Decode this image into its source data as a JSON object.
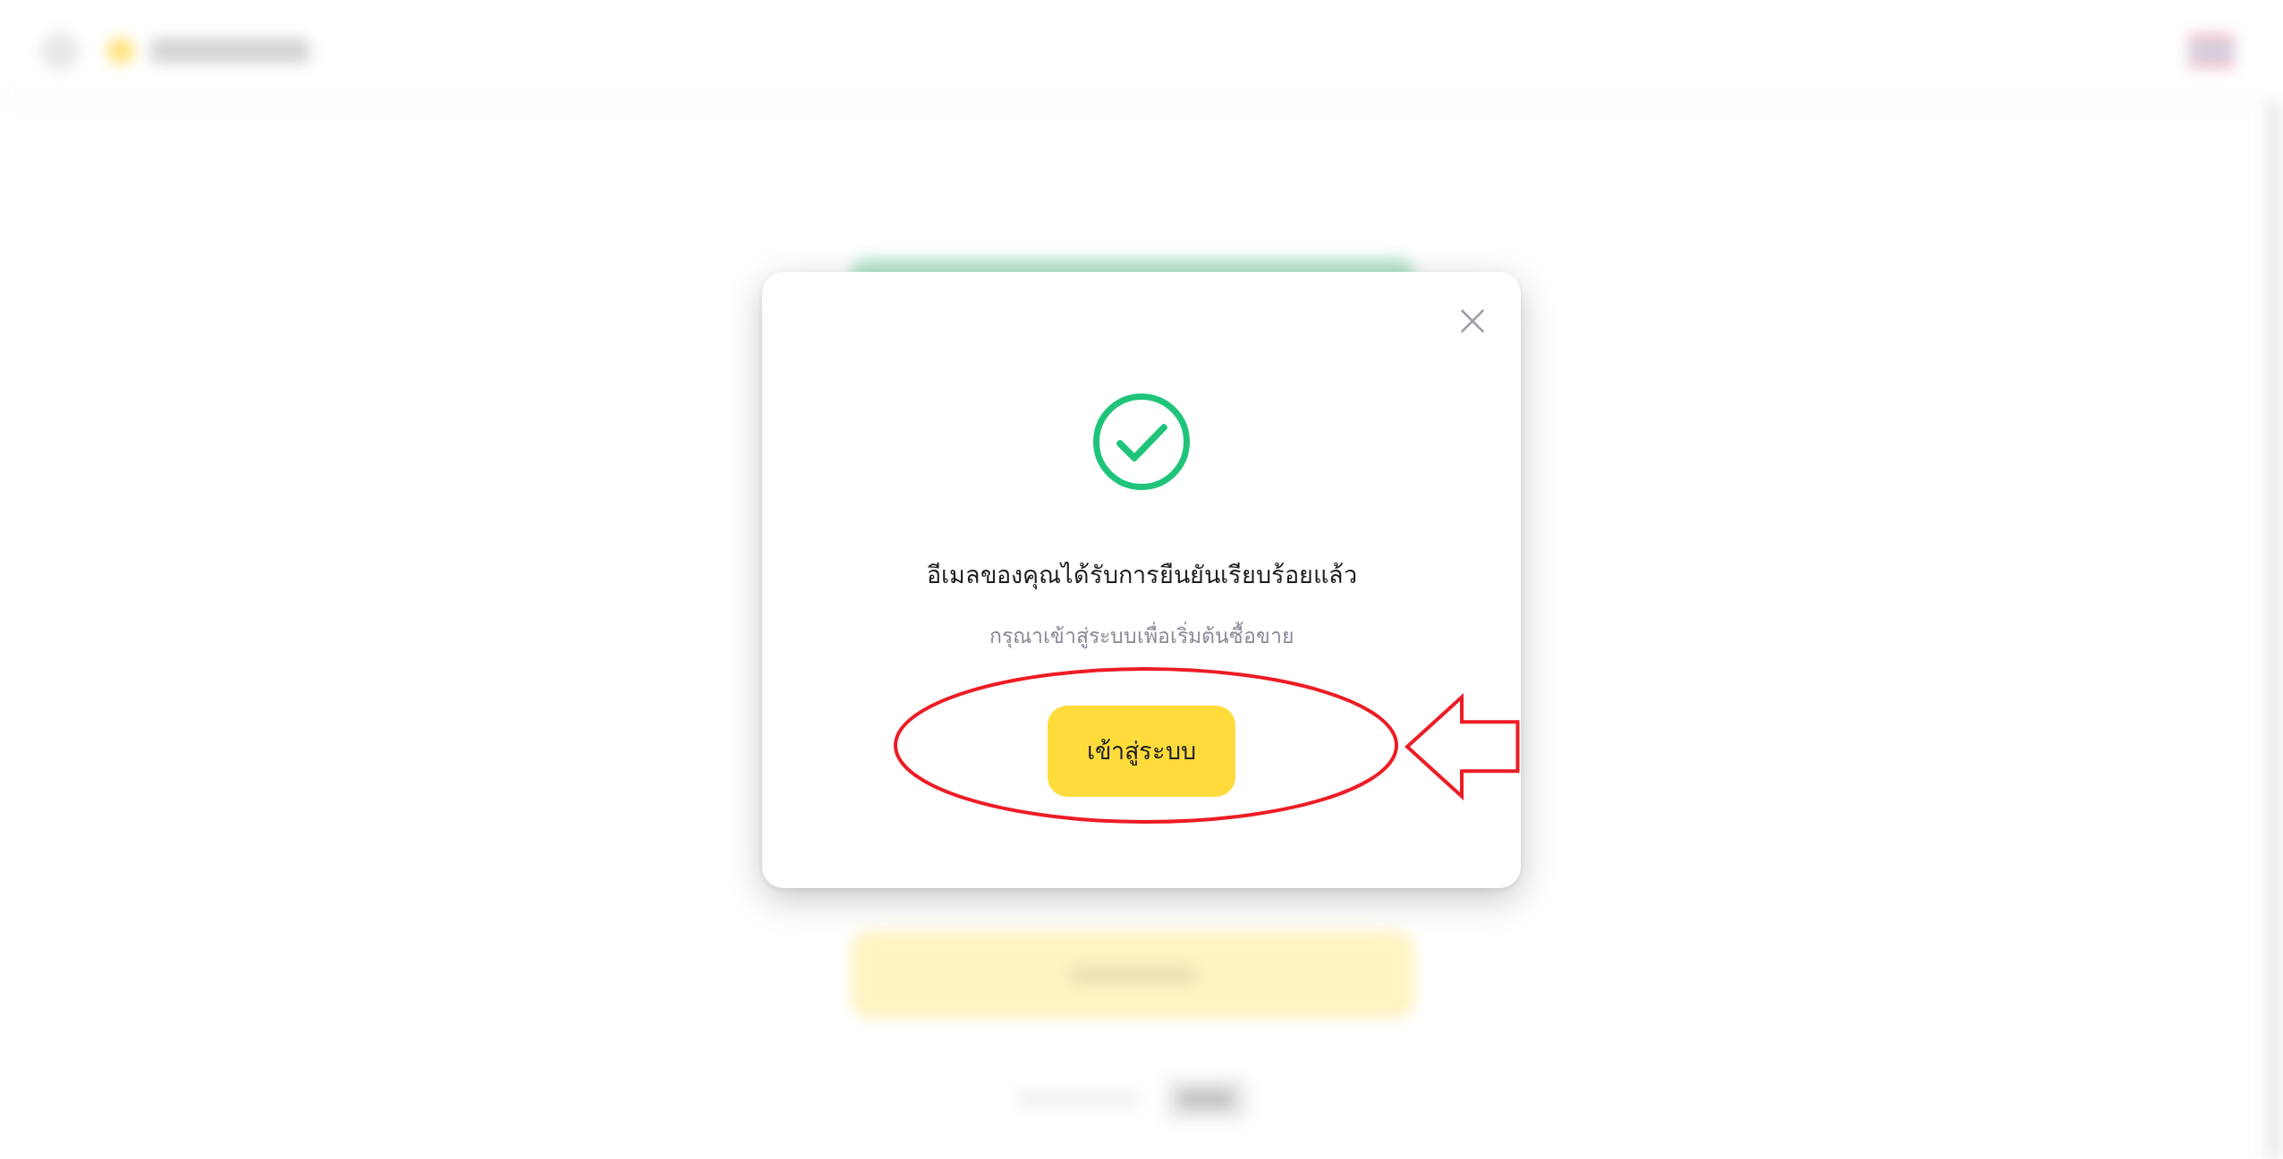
{
  "dialog": {
    "title": "อีเมลของคุณได้รับการยืนยันเรียบร้อยแล้ว",
    "message": "กรุณาเข้าสู่ระบบเพื่อเริ่มต้นซื้อขาย",
    "button": "เข้าสู่ระบบ"
  },
  "annotations": [
    {
      "kind": "ellipse"
    },
    {
      "kind": "arrow"
    }
  ]
}
